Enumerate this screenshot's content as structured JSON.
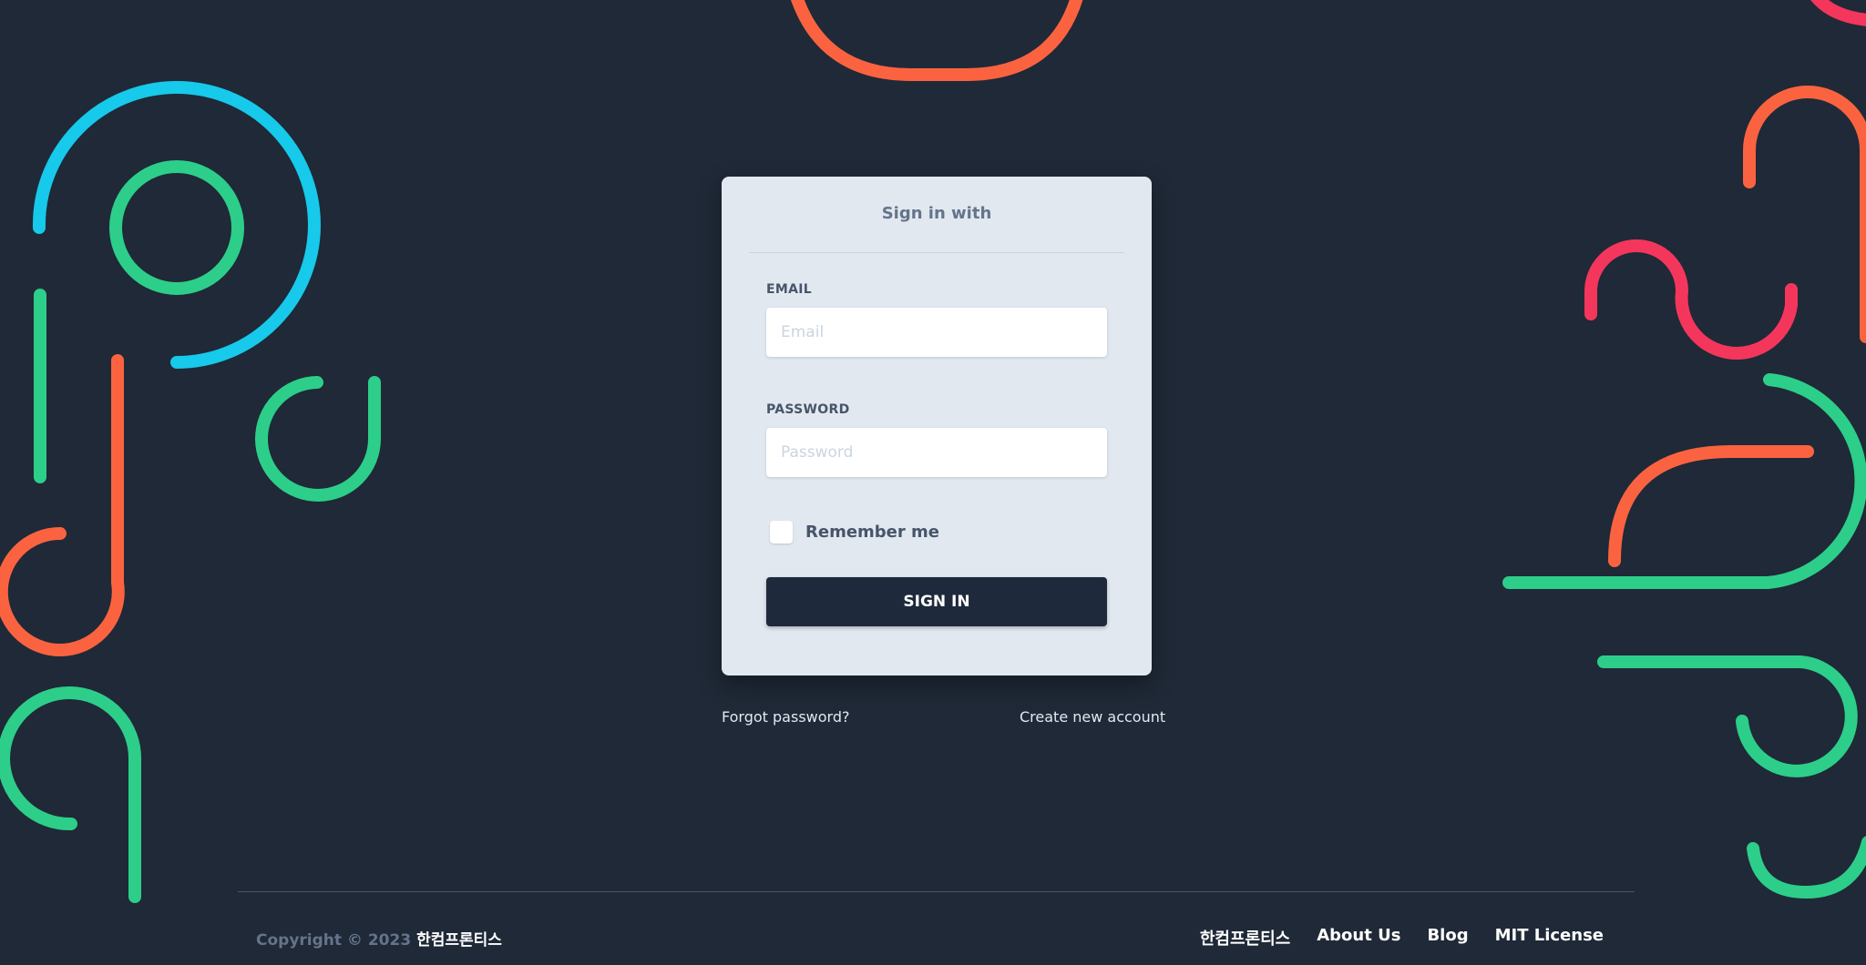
{
  "colors": {
    "background": "#1f2937",
    "card": "#e2e8f0",
    "button": "#1e293b",
    "accent_cyan": "#17c9ea",
    "accent_green": "#2dce89",
    "accent_orange": "#fb6340",
    "accent_pink": "#f5365c"
  },
  "login": {
    "heading": "Sign in with",
    "email_label": "EMAIL",
    "email_placeholder": "Email",
    "password_label": "PASSWORD",
    "password_placeholder": "Password",
    "remember_label": "Remember me",
    "signin_label": "SIGN IN"
  },
  "links": {
    "forgot": "Forgot password?",
    "create": "Create new account"
  },
  "footer": {
    "copyright_prefix": "Copyright © 2023",
    "copyright_brand": "한컴프론티스",
    "nav": [
      "한컴프론티스",
      "About Us",
      "Blog",
      "MIT License"
    ]
  }
}
